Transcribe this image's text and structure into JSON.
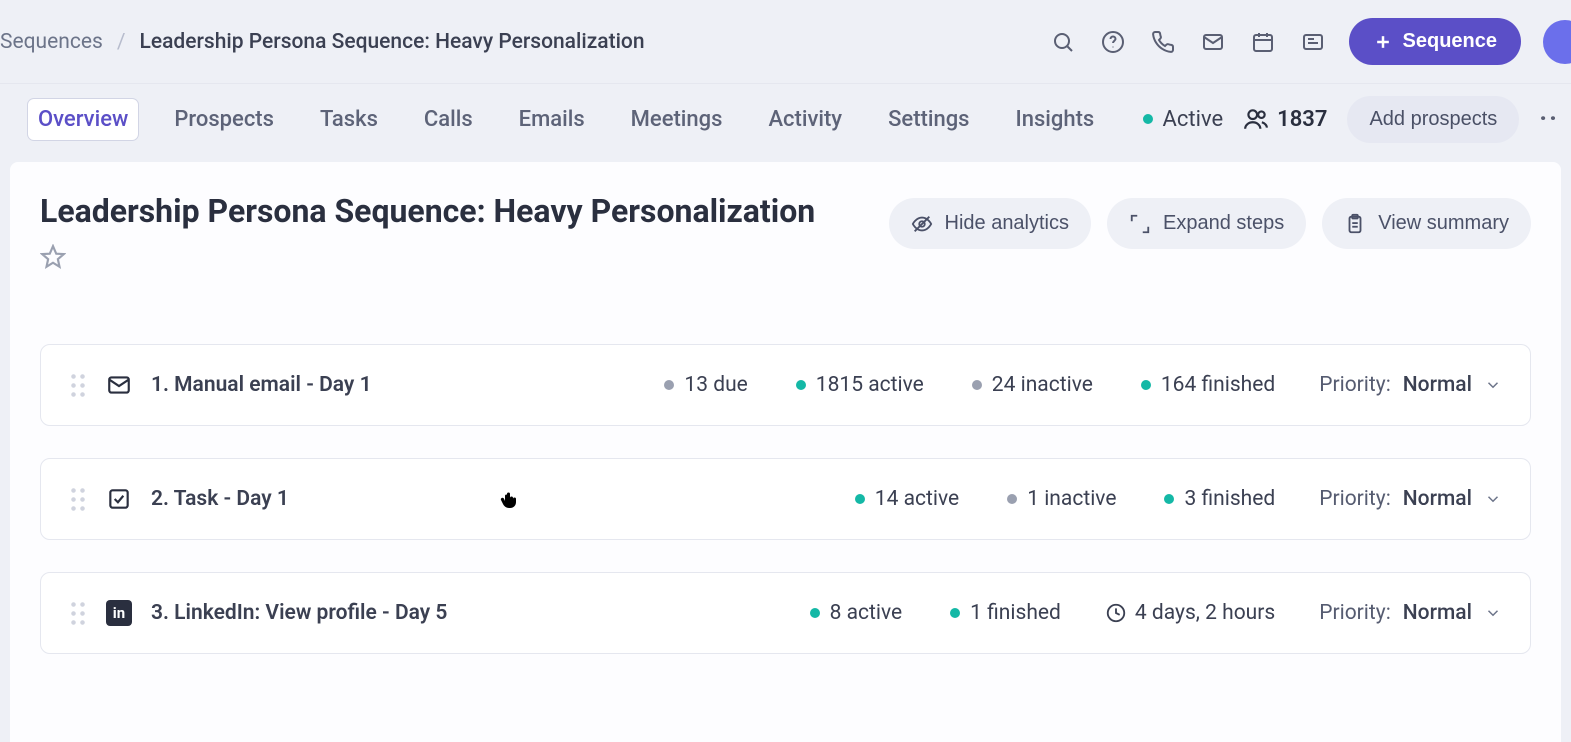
{
  "breadcrumb": {
    "root": "Sequences",
    "separator": "/",
    "current": "Leadership Persona Sequence: Heavy Personalization"
  },
  "topbar": {
    "sequence_button": "Sequence"
  },
  "tabs": {
    "items": [
      "Overview",
      "Prospects",
      "Tasks",
      "Calls",
      "Emails",
      "Meetings",
      "Activity",
      "Settings",
      "Insights"
    ],
    "active_index": 0
  },
  "status": {
    "label": "Active",
    "count": "1837",
    "add_prospects": "Add prospects"
  },
  "page": {
    "title": "Leadership Persona Sequence: Heavy Personalization"
  },
  "actions": {
    "hide_analytics": "Hide analytics",
    "expand_steps": "Expand steps",
    "view_summary": "View summary"
  },
  "priority_label": "Priority:",
  "steps": [
    {
      "icon": "mail",
      "title": "1. Manual email - Day 1",
      "stats": [
        {
          "color": "gray",
          "text": "13 due"
        },
        {
          "color": "teal",
          "text": "1815 active"
        },
        {
          "color": "gray",
          "text": "24 inactive"
        },
        {
          "color": "teal",
          "text": "164 finished"
        }
      ],
      "duration": "",
      "priority": "Normal"
    },
    {
      "icon": "task",
      "title": "2. Task - Day 1",
      "stats": [
        {
          "color": "teal",
          "text": "14 active"
        },
        {
          "color": "gray",
          "text": "1 inactive"
        },
        {
          "color": "teal",
          "text": "3 finished"
        }
      ],
      "duration": "",
      "priority": "Normal"
    },
    {
      "icon": "linkedin",
      "title": "3. LinkedIn: View profile - Day 5",
      "stats": [
        {
          "color": "teal",
          "text": "8 active"
        },
        {
          "color": "teal",
          "text": "1 finished"
        }
      ],
      "duration": "4 days, 2 hours",
      "priority": "Normal"
    }
  ]
}
